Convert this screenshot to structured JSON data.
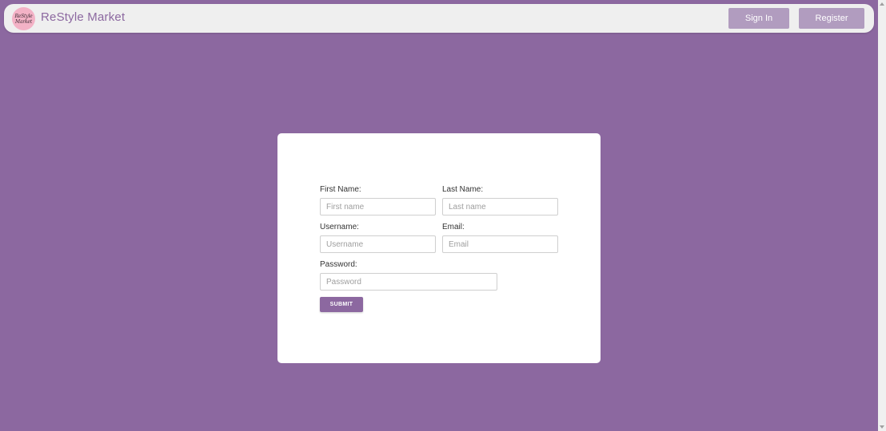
{
  "colors": {
    "background": "#8c68a0",
    "navbar": "#efefef",
    "nav_button": "#b19cbf",
    "accent": "#8c68a0",
    "logo_circle": "#f3b2c6"
  },
  "header": {
    "logo_icon": "restyle-market-logo",
    "logo_line1": "ReStyle",
    "logo_line2": "Market",
    "brand": "ReStyle Market",
    "sign_in_label": "Sign In",
    "register_label": "Register"
  },
  "form": {
    "first_name": {
      "label": "First Name:",
      "placeholder": "First name",
      "value": ""
    },
    "last_name": {
      "label": "Last Name:",
      "placeholder": "Last name",
      "value": ""
    },
    "username": {
      "label": "Username:",
      "placeholder": "Username",
      "value": ""
    },
    "email": {
      "label": "Email:",
      "placeholder": "Email",
      "value": ""
    },
    "password": {
      "label": "Password:",
      "placeholder": "Password",
      "value": ""
    },
    "submit_label": "SUBMIT"
  }
}
